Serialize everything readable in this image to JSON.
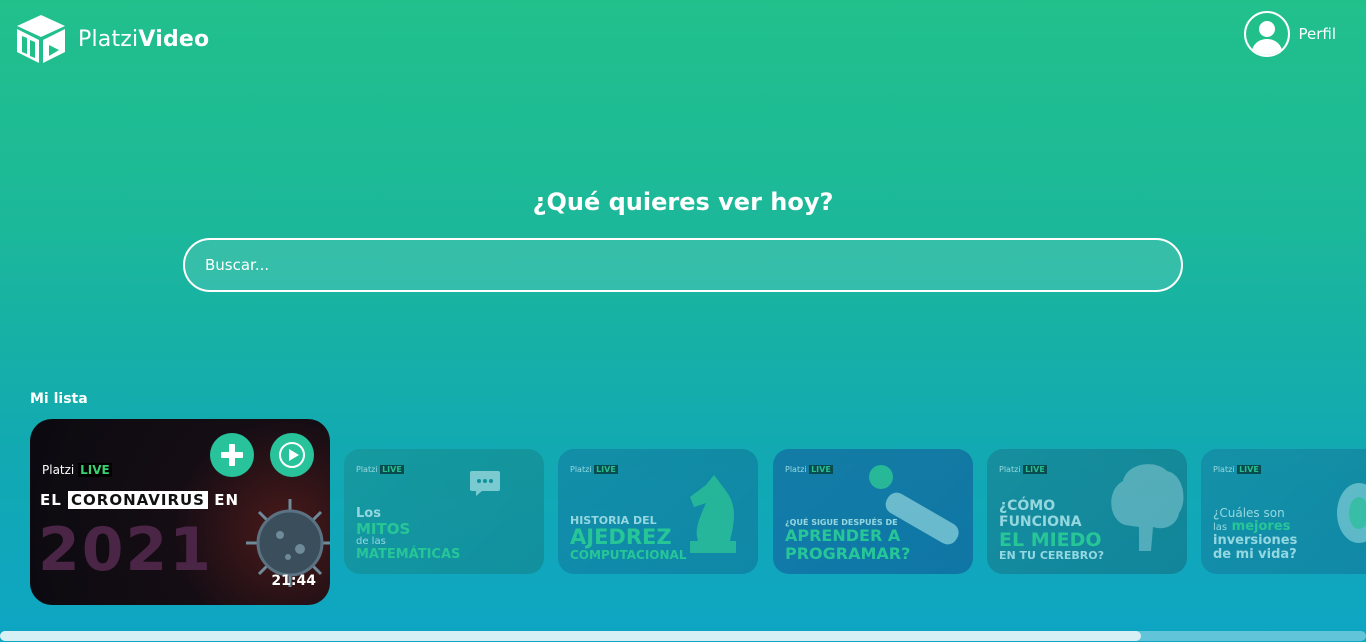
{
  "header": {
    "logo_part1": "Platzi",
    "logo_part2": "Video",
    "profile_label": "Perfil"
  },
  "hero": {
    "title": "¿Qué quieres ver hoy?",
    "search_placeholder": "Buscar..."
  },
  "mylist": {
    "title": "Mi lista",
    "featured": {
      "brand": "Platzi",
      "brand_tag": "LIVE",
      "headline_1": "EL",
      "headline_boxed": "CORONAVIRUS",
      "headline_2": "EN",
      "year": "2021",
      "duration": "21:44",
      "add_icon": "plus-icon",
      "play_icon": "play-icon"
    },
    "cards": [
      {
        "brand": "Platzi",
        "brand_tag": "LIVE",
        "l1": "Los",
        "l2": "MITOS",
        "l3": "de las",
        "l4": "MATEMÁTICAS"
      },
      {
        "brand": "Platzi",
        "brand_tag": "LIVE",
        "l1": "HISTORIA DEL",
        "l2": "AJEDREZ",
        "l3": "COMPUTACIONAL"
      },
      {
        "brand": "Platzi",
        "brand_tag": "LIVE",
        "l1": "¿QUÉ SIGUE DESPUÉS DE",
        "l2": "APRENDER A",
        "l3": "PROGRAMAR?"
      },
      {
        "brand": "Platzi",
        "brand_tag": "LIVE",
        "l1": "¿CÓMO",
        "l2": "FUNCIONA",
        "l3": "EL MIEDO",
        "l4": "EN TU CEREBRO?"
      },
      {
        "brand": "Platzi",
        "brand_tag": "LIVE",
        "l1": "¿Cuáles son",
        "l2": "las",
        "l3": "mejores",
        "l4": "inversiones",
        "l5": "de mi vida?"
      }
    ]
  },
  "colors": {
    "gradient_top": "#21c08b",
    "gradient_bottom": "#0ea5c4",
    "accent": "#28c39a"
  }
}
